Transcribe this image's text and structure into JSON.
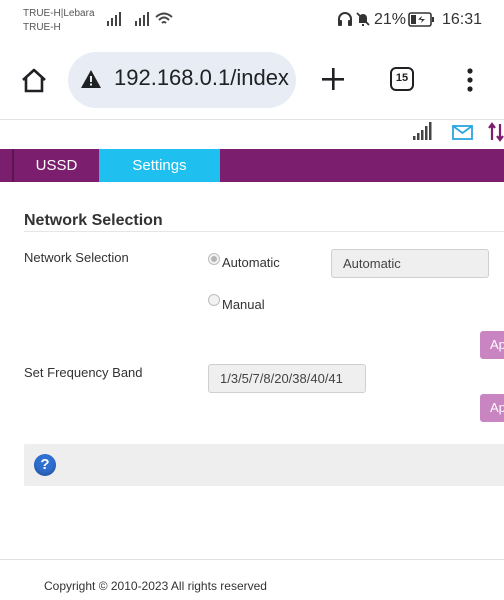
{
  "status_bar": {
    "carrier_line1": "TRUE-H|Lebara",
    "carrier_line2": "TRUE-H",
    "battery": "21%",
    "time": "16:31",
    "icons": [
      "signal-icon",
      "signal-icon",
      "wifi-icon",
      "headphones-icon",
      "mute-icon",
      "battery-icon"
    ]
  },
  "browser": {
    "url": "192.168.0.1/index",
    "tab_count": "15",
    "icons": [
      "home-icon",
      "warning-icon",
      "new-tab-icon",
      "tabs-icon",
      "more-icon"
    ]
  },
  "router": {
    "status_icons": [
      "signal-strength-icon",
      "mail-icon",
      "data-transfer-icon"
    ],
    "accent_color": "#7b1e6e",
    "active_tab_color": "#1fc0f0",
    "menu": {
      "tabs": [
        {
          "label": "USSD",
          "active": false
        },
        {
          "label": "Settings",
          "active": true
        }
      ]
    },
    "section_title": "Network Selection",
    "network_selection": {
      "label": "Network Selection",
      "options": [
        {
          "label": "Automatic",
          "checked": true
        },
        {
          "label": "Manual",
          "checked": false
        }
      ],
      "value": "Automatic"
    },
    "apply_label": "Ap",
    "frequency_band": {
      "label": "Set Frequency Band",
      "value": "1/3/5/7/8/20/38/40/41"
    },
    "copyright": "Copyright © 2010-2023 All rights reserved"
  }
}
